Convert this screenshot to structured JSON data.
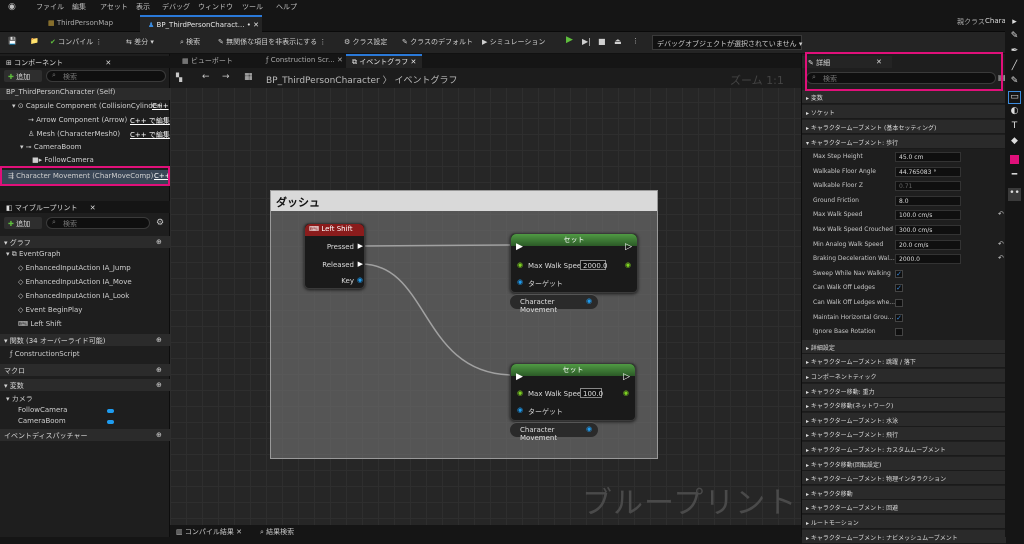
{
  "menu": [
    "ファイル",
    "編集",
    "アセット",
    "表示",
    "デバッグ",
    "ウィンドウ",
    "ツール",
    "ヘルプ"
  ],
  "tabs": {
    "map": "ThirdPersonMap",
    "bp": "BP_ThirdPersonCharact... •"
  },
  "parent_class": {
    "label": "親クラス",
    "value": "Charac"
  },
  "toolbar": {
    "compile": "コンパイル",
    "diff": "差分",
    "find": "検索",
    "hide": "無関係な項目を非表示にする",
    "class_settings": "クラス設定",
    "class_defaults": "クラスのデフォルト",
    "simulation": "シミュレーション",
    "debug_object": "デバッグオブジェクトが選択されていません"
  },
  "components": {
    "title": "コンポーネント",
    "add": "追加",
    "search_placeholder": "検索",
    "items": [
      {
        "label": "BP_ThirdPersonCharacter (Self)",
        "edit": ""
      },
      {
        "label": "Capsule Component (CollisionCylinder)",
        "edit": "C++"
      },
      {
        "label": "Arrow Component (Arrow)",
        "edit": "C++ で編集"
      },
      {
        "label": "Mesh (CharacterMesh0)",
        "edit": "C++ で編集"
      },
      {
        "label": "CameraBoom",
        "edit": ""
      },
      {
        "label": "FollowCamera",
        "edit": ""
      },
      {
        "label": "Character Movement (CharMoveComp)",
        "edit": "C++"
      }
    ]
  },
  "my_blueprint": {
    "title": "マイブループリント",
    "add": "追加",
    "search_placeholder": "検索",
    "graph_section": "グラフ",
    "event_graph": "EventGraph",
    "graph_items": [
      "EnhancedInputAction IA_Jump",
      "EnhancedInputAction IA_Move",
      "EnhancedInputAction IA_Look",
      "Event BeginPlay",
      "Left Shift"
    ],
    "functions_section": "関数 (34 オーバーライド可能)",
    "construction": "ConstructionScript",
    "macros": "マクロ",
    "variables": "変数",
    "camera_cat": "カメラ",
    "vars": [
      "FollowCamera",
      "CameraBoom"
    ],
    "dispatchers": "イベントディスパッチャー"
  },
  "graph": {
    "tabs": [
      "ビューポート",
      "Construction Scr...",
      "イベントグラフ"
    ],
    "breadcrumb_bp": "BP_ThirdPersonCharacter",
    "breadcrumb_graph": "イベントグラフ",
    "zoom": "ズーム 1:1",
    "comment": "ダッシュ",
    "input_node": {
      "title": "Left Shift",
      "pins": [
        "Pressed",
        "Released",
        "Key"
      ]
    },
    "set1": {
      "title": "セット",
      "pin": "Max Walk Speed",
      "value": "2000.0",
      "target": "ターゲット"
    },
    "set2": {
      "title": "セット",
      "pin": "Max Walk Speed",
      "value": "100.0",
      "target": "ターゲット"
    },
    "var_node": "Character Movement",
    "watermark": "ブループリント",
    "bottom_tabs": [
      "コンパイル結果",
      "結果検索"
    ]
  },
  "details": {
    "title": "詳細",
    "search_placeholder": "検索",
    "top_sections": [
      "変数",
      "ソケット",
      "キャラクタームーブメント (基本セッティング)",
      "キャラクタームーブメント: 歩行"
    ],
    "props": [
      {
        "name": "Max Step Height",
        "value": "45.0 cm",
        "type": "num"
      },
      {
        "name": "Walkable Floor Angle",
        "value": "44.765083 °",
        "type": "num"
      },
      {
        "name": "Walkable Floor Z",
        "value": "0.71",
        "type": "dim"
      },
      {
        "name": "Ground Friction",
        "value": "8.0",
        "type": "num"
      },
      {
        "name": "Max Walk Speed",
        "value": "100.0 cm/s",
        "type": "num",
        "reset": true
      },
      {
        "name": "Max Walk Speed Crouched",
        "value": "300.0 cm/s",
        "type": "num"
      },
      {
        "name": "Min Analog Walk Speed",
        "value": "20.0 cm/s",
        "type": "num",
        "reset": true
      },
      {
        "name": "Braking Deceleration Wal...",
        "value": "2000.0",
        "type": "num",
        "reset": true
      },
      {
        "name": "Sweep While Nav Walking",
        "value": "✓",
        "type": "check"
      },
      {
        "name": "Can Walk Off Ledges",
        "value": "✓",
        "type": "check"
      },
      {
        "name": "Can Walk Off Ledges whe...",
        "value": "",
        "type": "check"
      },
      {
        "name": "Maintain Horizontal Grou...",
        "value": "✓",
        "type": "check"
      },
      {
        "name": "Ignore Base Rotation",
        "value": "",
        "type": "check"
      }
    ],
    "sections": [
      "詳細設定",
      "キャラクタームーブメント: 跳躍 / 落下",
      "コンポーネントティック",
      "キャラクター移動: 重力",
      "キャラクタ移動(ネットワーク)",
      "キャラクタームーブメント: 水泳",
      "キャラクタームーブメント: 飛行",
      "キャラクタームーブメント: カスタムムーブメント",
      "キャラクタ移動(回転設定)",
      "キャラクタームーブメント: 物理インタラクション",
      "キャラクタ移動",
      "キャラクタームーブメント: 回避",
      "ルートモーション",
      "キャラクタームーブメント: ナビメッシュムーブメント"
    ]
  },
  "colors": {
    "accent": "#2a79d8",
    "highlight": "#e0107a",
    "exec_wire": "#ffffff",
    "float_pin": "#7ed321",
    "object_pin": "#1e9cf0",
    "set_header": "#3e7d3a",
    "input_header": "#8a1c1c"
  }
}
